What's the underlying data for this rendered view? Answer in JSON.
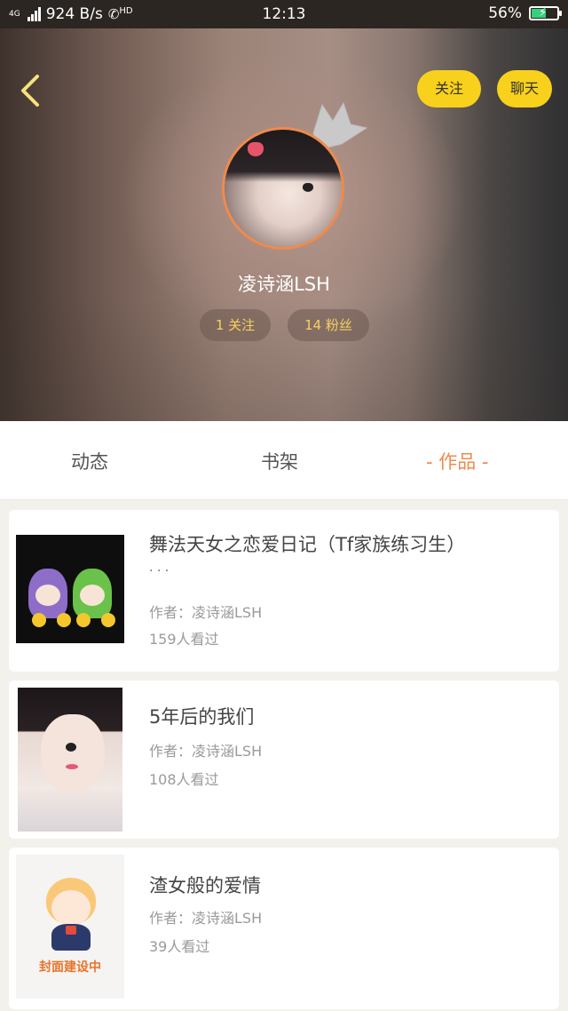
{
  "status_bar": {
    "network": "4G",
    "speed": "924 B/s",
    "call_badge": "HD",
    "time": "12:13",
    "battery": "56%",
    "battery_level": 0.56
  },
  "header": {
    "follow_button": "关注",
    "chat_button": "聊天",
    "username": "凌诗涵LSH",
    "following": "1 关注",
    "fans": "14 粉丝"
  },
  "tabs": [
    {
      "label": "动态"
    },
    {
      "label": "书架"
    },
    {
      "label": "- 作品 -",
      "active": true
    }
  ],
  "works": [
    {
      "title": "舞法天女之恋爱日记（Tf家族练习生）",
      "ellipsis": "· · ·",
      "author": "作者：凌诗涵LSH",
      "views": "159人看过"
    },
    {
      "title": "5年后的我们",
      "author": "作者：凌诗涵LSH",
      "views": "108人看过"
    },
    {
      "title": "渣女般的爱情",
      "author": "作者：凌诗涵LSH",
      "views": "39人看过",
      "cover_caption": "封面建设中"
    }
  ],
  "colors": {
    "accent_yellow": "#f8d11c",
    "accent_orange": "#f08a4c",
    "stat_text": "#f7d060"
  }
}
